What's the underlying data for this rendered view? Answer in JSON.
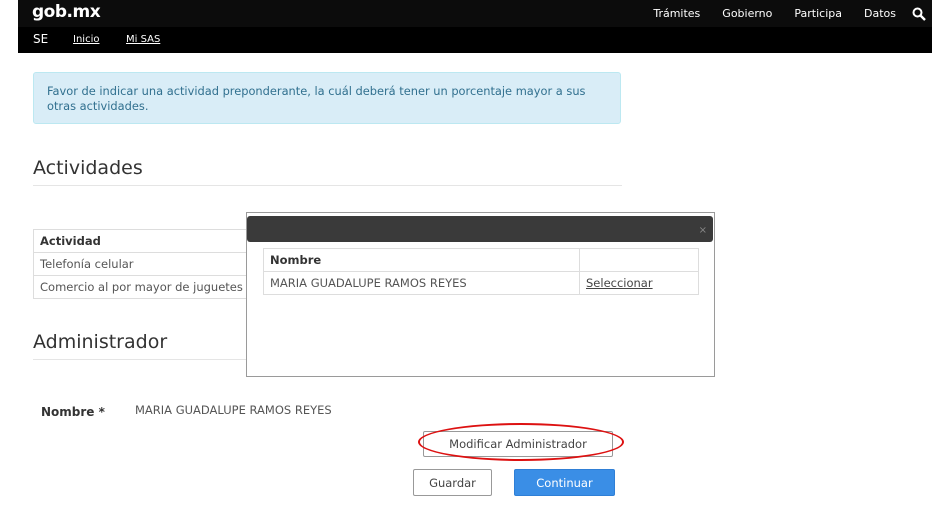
{
  "header": {
    "logo": "gob.mx",
    "nav": [
      "Trámites",
      "Gobierno",
      "Participa",
      "Datos"
    ],
    "search_icon": "search-icon"
  },
  "subnav": {
    "brand": "SE",
    "links": [
      "Inicio",
      "Mi SAS"
    ]
  },
  "alert": {
    "text": "Favor de indicar una actividad preponderante, la cuál deberá tener un porcentaje mayor a sus otras actividades."
  },
  "actividades": {
    "title": "Actividades",
    "column": "Actividad",
    "rows": [
      "Telefonía celular",
      "Comercio al por mayor de juguetes"
    ]
  },
  "administrador": {
    "title": "Administrador",
    "name_label": "Nombre *",
    "name_value": "MARIA GUADALUPE RAMOS REYES",
    "modify_button": "Modificar Administrador",
    "save_button": "Guardar",
    "continue_button": "Continuar"
  },
  "modal": {
    "close": "×",
    "column": "Nombre",
    "rows": [
      {
        "name": "MARIA GUADALUPE RAMOS REYES",
        "action": "Seleccionar"
      }
    ]
  },
  "colors": {
    "alert_bg": "#d9edf7",
    "primary": "#3a8ee6",
    "highlight_ring": "#dd1111"
  }
}
